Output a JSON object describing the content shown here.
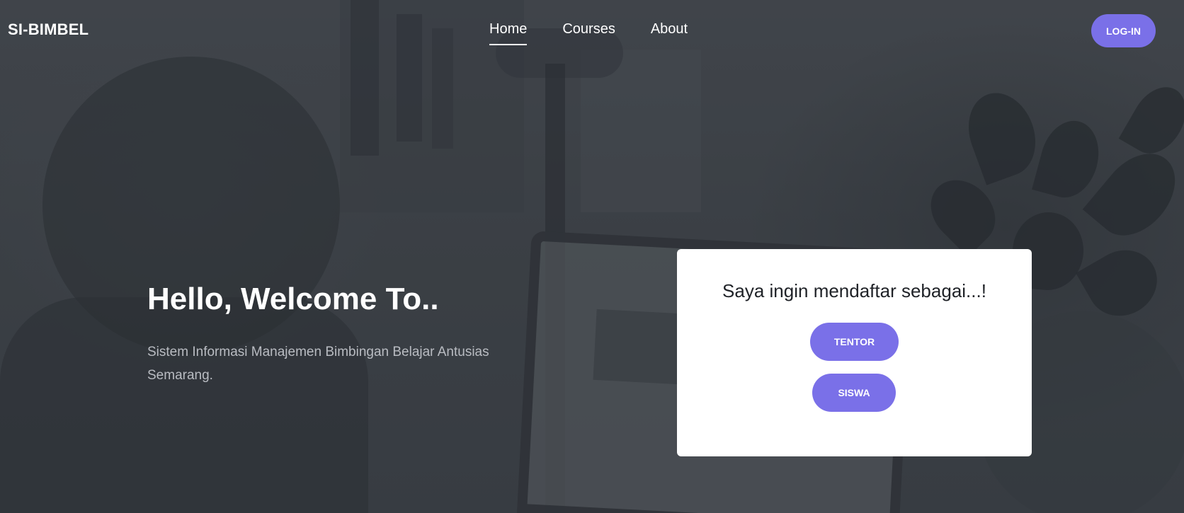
{
  "navbar": {
    "brand": "SI-BIMBEL",
    "links": [
      {
        "label": "Home",
        "active": true
      },
      {
        "label": "Courses",
        "active": false
      },
      {
        "label": "About",
        "active": false
      }
    ],
    "login_label": "LOG-IN"
  },
  "hero": {
    "title": "Hello, Welcome To..",
    "subtitle": "Sistem Informasi Manajemen Bimbingan Belajar Antusias Semarang."
  },
  "register_card": {
    "title": "Saya ingin mendaftar sebagai...!",
    "buttons": [
      {
        "label": "TENTOR"
      },
      {
        "label": "SISWA"
      }
    ]
  },
  "colors": {
    "accent": "#7a70e8",
    "card_background": "#ffffff",
    "hero_overlay": "#3f4349"
  }
}
